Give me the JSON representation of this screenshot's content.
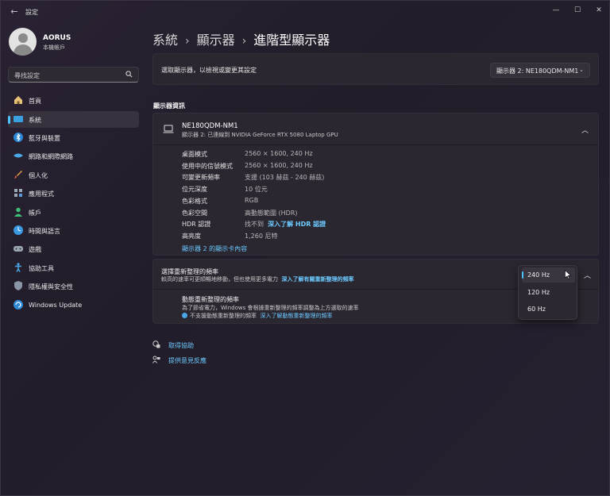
{
  "window": {
    "app_title": "設定",
    "back_glyph": "←",
    "minimize_glyph": "—",
    "maximize_glyph": "☐",
    "close_glyph": "✕"
  },
  "profile": {
    "name": "AORUS",
    "subtitle": "本機帳戶"
  },
  "search": {
    "placeholder": "尋找設定"
  },
  "sidebar": {
    "items": [
      {
        "label": "首頁",
        "icon": "home-icon"
      },
      {
        "label": "系統",
        "icon": "system-icon",
        "active": true
      },
      {
        "label": "藍牙與裝置",
        "icon": "bluetooth-icon"
      },
      {
        "label": "網路和網際網路",
        "icon": "network-icon"
      },
      {
        "label": "個人化",
        "icon": "brush-icon"
      },
      {
        "label": "應用程式",
        "icon": "apps-icon"
      },
      {
        "label": "帳戶",
        "icon": "account-icon"
      },
      {
        "label": "時間與語言",
        "icon": "time-language-icon"
      },
      {
        "label": "遊戲",
        "icon": "gaming-icon"
      },
      {
        "label": "協助工具",
        "icon": "accessibility-icon"
      },
      {
        "label": "隱私權與安全性",
        "icon": "shield-icon"
      },
      {
        "label": "Windows Update",
        "icon": "windows-update-icon"
      }
    ]
  },
  "breadcrumb": {
    "level1": "系統",
    "level2": "顯示器",
    "level3": "進階型顯示器",
    "sep": "›"
  },
  "display_select": {
    "label": "選取顯示器，以檢視或變更其設定",
    "value": "顯示器 2: NE180QDM-NM1",
    "chevron": "⌄"
  },
  "display_info": {
    "section_title": "顯示器資訊",
    "monitor_name": "NE180QDM-NM1",
    "monitor_sub": "顯示器 2: 已連線到 NVIDIA GeForce RTX 5080 Laptop GPU",
    "collapse_glyph": "︿",
    "rows": [
      {
        "label": "桌面模式",
        "value": "2560 × 1600, 240 Hz"
      },
      {
        "label": "使用中的信號模式",
        "value": "2560 × 1600, 240 Hz"
      },
      {
        "label": "可變更新頻率",
        "value": "支援 (103 赫茲 - 240 赫茲)"
      },
      {
        "label": "位元深度",
        "value": "10 位元"
      },
      {
        "label": "色彩格式",
        "value": "RGB"
      },
      {
        "label": "色彩空間",
        "value": "高動態範圍 (HDR)"
      },
      {
        "label": "HDR 認證",
        "value": "找不到",
        "link": "深入了解 HDR 認證"
      },
      {
        "label": "高亮度",
        "value": "1,260 尼特"
      }
    ],
    "adapter_link": "顯示器 2 的顯示卡內容"
  },
  "refresh": {
    "title": "選擇重新整理的頻率",
    "desc": "較高的速率可更順暢地移動，但也使用更多電力",
    "desc_link": "深入了解有關重新整理的頻率",
    "dynamic_title": "動態重新整理的頻率",
    "dynamic_desc": "為了節省電力，Windows 會根據重新整理的頻率調整為上方選取的速率",
    "dynamic_warn": "不支援動態重新整理的頻率",
    "dynamic_warn_link": "深入了解動態重新整理的頻率",
    "options": [
      "240 Hz",
      "120 Hz",
      "60 Hz"
    ],
    "selected": "240 Hz",
    "collapse_glyph": "︿"
  },
  "help": {
    "get_help": "取得協助",
    "feedback": "提供意見反應"
  },
  "colors": {
    "accent": "#4cc2ff",
    "link": "#6cc9ff"
  }
}
